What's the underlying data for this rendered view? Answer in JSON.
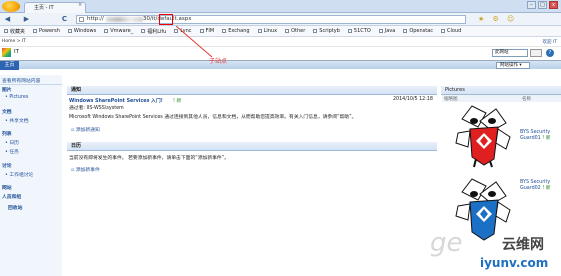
{
  "browser": {
    "tab_title": "主页 - IT",
    "tab_close": "×",
    "address_prefix": "http://",
    "address_path": "30/it/default.aspx",
    "nav_back": "◀",
    "nav_forward": "▶",
    "nav_refresh": "C",
    "favorites": [
      "收藏夹",
      "Powersh",
      "Windows",
      "Vmware_",
      "福利Lifu",
      "Lync",
      "FIM",
      "Exchang",
      "Linux",
      "Other",
      "Scriptyb",
      "51CTO",
      "Java",
      "Openstac",
      "Cloud"
    ]
  },
  "sharepoint": {
    "breadcrumb": "Home > IT",
    "top_right_link": "欢迎 IT",
    "site_title": "IT",
    "home_tab": "主页",
    "site_actions": "此网站",
    "annotation_label": "子站点",
    "leftnav": {
      "view_all": "查看所有网站内容",
      "sections": [
        {
          "title": "图片",
          "items": [
            "Pictures"
          ]
        },
        {
          "title": "文档",
          "items": [
            "共享文档"
          ]
        },
        {
          "title": "列表",
          "items": [
            "日历",
            "任务"
          ]
        },
        {
          "title": "讨论",
          "items": [
            "工作组讨论"
          ]
        },
        {
          "title": "网站",
          "items": []
        },
        {
          "title": "人员和组",
          "items": []
        },
        {
          "title": "回收站",
          "items": []
        }
      ]
    },
    "announcements": {
      "title": "通知",
      "item_title": "Windows SharePoint Services 入门!",
      "new_badge": "! 新",
      "item_date": "2014/10/5 12:18",
      "item_author": "通过者: IIS-WSS\\system",
      "item_body": "Microsoft Windows SharePoint Services 通过连接到其他人员，信息和文档，从而帮助您提高效率。有关入门信息，请参阅“帮助”。",
      "add_link": "添加新通知"
    },
    "calendar": {
      "title": "日历",
      "empty_text": "当前没有即将发生的事件。 若要添加新事件，请单击下面的“添加新事件”。",
      "add_link": "添加新事件"
    },
    "pictures": {
      "title": "Pictures",
      "col_thumb": "缩略图",
      "col_name": "名称",
      "items": [
        {
          "name": "BYS Security Guard01",
          "badge": "! 新"
        },
        {
          "name": "BYS Security Guard02",
          "badge": "! 新"
        }
      ]
    }
  },
  "watermark": {
    "site": "iyunv.com",
    "text": "云维网"
  },
  "colors": {
    "accent": "#1f4f99",
    "home_tab": "#2d63b3",
    "annotation": "#e53935"
  }
}
